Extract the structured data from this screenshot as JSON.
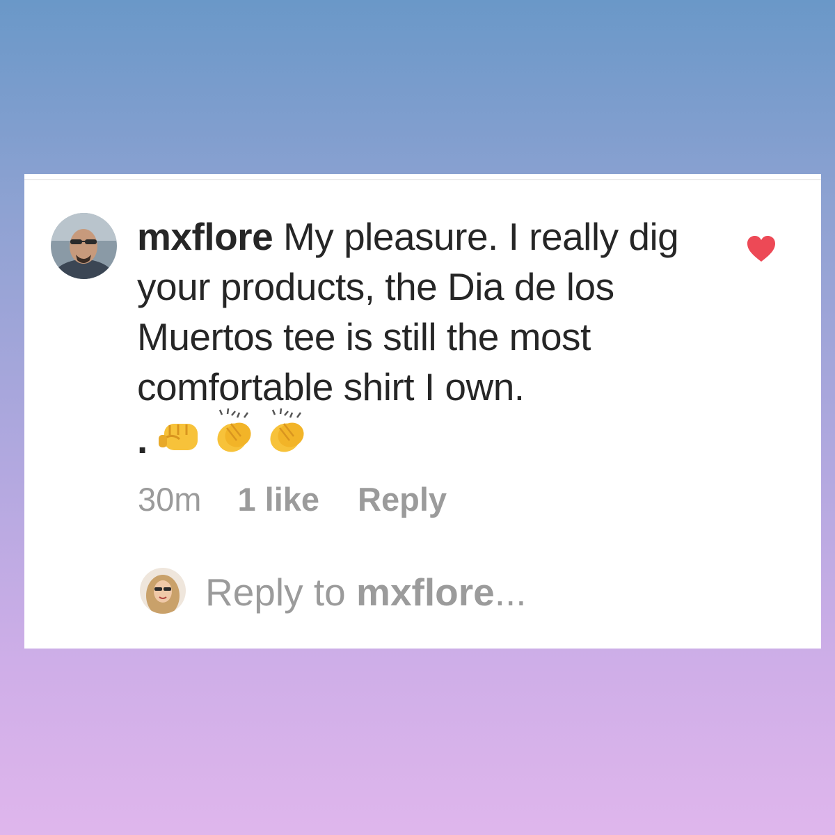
{
  "comment": {
    "username": "mxflore",
    "text": "My pleasure.  I really dig your products, the Dia de los Muertos tee is still the most comfortable shirt I own.",
    "trailing_text": ".",
    "emojis": [
      "oncoming-fist",
      "clapping-hands",
      "clapping-hands"
    ],
    "liked": true
  },
  "meta": {
    "time": "30m",
    "likes": "1 like",
    "reply_label": "Reply"
  },
  "reply_box": {
    "prefix": "Reply to ",
    "target": "mxflore",
    "suffix": "..."
  },
  "colors": {
    "text": "#262626",
    "muted": "#9b9b9b",
    "heart": "#ed4956",
    "emoji": "#f7c23a"
  }
}
